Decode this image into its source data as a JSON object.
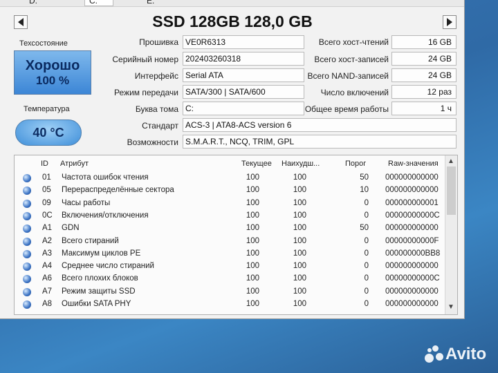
{
  "drives": {
    "d": "D:",
    "c": "C:",
    "e": "E:"
  },
  "title": "SSD 128GB 128,0 GB",
  "health": {
    "label": "Техсостояние",
    "status": "Хорошо",
    "percent": "100 %"
  },
  "temperature": {
    "label": "Температура",
    "value": "40 °C"
  },
  "info": [
    {
      "label": "Прошивка",
      "value": "VE0R6313"
    },
    {
      "label": "Серийный номер",
      "value": "202403260318"
    },
    {
      "label": "Интерфейс",
      "value": "Serial ATA"
    },
    {
      "label": "Режим передачи",
      "value": "SATA/300 | SATA/600"
    },
    {
      "label": "Буква тома",
      "value": "C:"
    },
    {
      "label": "Стандарт",
      "value": "ACS-3 | ATA8-ACS version 6"
    },
    {
      "label": "Возможности",
      "value": "S.M.A.R.T., NCQ, TRIM, GPL"
    }
  ],
  "stats": [
    {
      "label": "Всего хост-чтений",
      "value": "16 GB"
    },
    {
      "label": "Всего хост-записей",
      "value": "24 GB"
    },
    {
      "label": "Всего NAND-записей",
      "value": "24 GB"
    },
    {
      "label": "Число включений",
      "value": "12 раз"
    },
    {
      "label": "Общее время работы",
      "value": "1 ч"
    }
  ],
  "table": {
    "headers": {
      "id": "ID",
      "attr": "Атрибут",
      "cur": "Текущее",
      "worst": "Наихудш...",
      "thr": "Порог",
      "raw": "Raw-значения"
    },
    "rows": [
      {
        "id": "01",
        "attr": "Частота ошибок чтения",
        "cur": "100",
        "worst": "100",
        "thr": "50",
        "raw": "000000000000"
      },
      {
        "id": "05",
        "attr": "Перераспределённые сектора",
        "cur": "100",
        "worst": "100",
        "thr": "10",
        "raw": "000000000000"
      },
      {
        "id": "09",
        "attr": "Часы работы",
        "cur": "100",
        "worst": "100",
        "thr": "0",
        "raw": "000000000001"
      },
      {
        "id": "0C",
        "attr": "Включения/отключения",
        "cur": "100",
        "worst": "100",
        "thr": "0",
        "raw": "00000000000C"
      },
      {
        "id": "A1",
        "attr": "GDN",
        "cur": "100",
        "worst": "100",
        "thr": "50",
        "raw": "000000000000"
      },
      {
        "id": "A2",
        "attr": "Всего стираний",
        "cur": "100",
        "worst": "100",
        "thr": "0",
        "raw": "00000000000F"
      },
      {
        "id": "A3",
        "attr": "Максимум циклов PE",
        "cur": "100",
        "worst": "100",
        "thr": "0",
        "raw": "000000000BB8"
      },
      {
        "id": "A4",
        "attr": "Среднее число стираний",
        "cur": "100",
        "worst": "100",
        "thr": "0",
        "raw": "000000000000"
      },
      {
        "id": "A6",
        "attr": "Всего плохих блоков",
        "cur": "100",
        "worst": "100",
        "thr": "0",
        "raw": "00000000000C"
      },
      {
        "id": "A7",
        "attr": "Режим защиты SSD",
        "cur": "100",
        "worst": "100",
        "thr": "0",
        "raw": "000000000000"
      },
      {
        "id": "A8",
        "attr": "Ошибки SATA PHY",
        "cur": "100",
        "worst": "100",
        "thr": "0",
        "raw": "000000000000"
      }
    ]
  },
  "watermark": "Avito",
  "colors": {
    "health_blue": "#3c86d6",
    "desktop": "#2f6aa6"
  }
}
